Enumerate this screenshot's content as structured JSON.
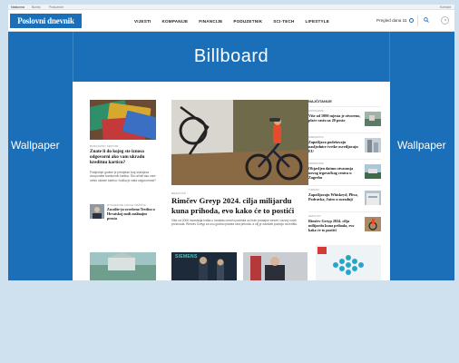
{
  "topbar": {
    "items": [
      "Naslovna",
      "Biznis",
      "Poduzeće",
      "Kontakt"
    ]
  },
  "header": {
    "logo": "Poslovni dnevnik",
    "menu": [
      "VIJESTI",
      "KOMPANIJE",
      "FINANCIJE",
      "PODUZETNIK",
      "SCI-TECH",
      "LIFESTYLE"
    ],
    "pregled_label": "Pregled dana",
    "pregled_count": "11"
  },
  "ads": {
    "billboard": "Billboard",
    "wallpaper_left": "Wallpaper",
    "wallpaper_right": "Wallpaper"
  },
  "articles": {
    "card1": {
      "tag": "BANKARSKI SEKTOR",
      "title": "Znate li do kojeg ste iznosa odgovorni ako vam ukradu kreditnu karticu?",
      "text": "Posljednje godine je primjetan broj slučajeva zlouporabe bankovnih kartica. Što učiniti ako vam netko ukrade karticu i kolika je vaša odgovornost?"
    },
    "card2": {
      "tag": "OTVARANJE NOVIH TRŽIŠTA",
      "title": "Zacalite-ju ovorkena Tredica u Hrvatskoj nuđi zaslinajne prosta"
    },
    "main": {
      "tag": "REZULTATI",
      "title": "Rimčev Greyp 2024. cilja milijardu kuna prihoda, evo kako će to postići",
      "text": "Više od 2000 investicija tvrtka u hrvatsku mrežu podrška uz brže prodajne mreže i razvoj novih proizvoda. Rimčev Greyp za ovu godinu planira rast prihoda, a cilj je zadržati poziciju na tržištu."
    }
  },
  "sidebar": {
    "title": "NAJČITANIJE",
    "items": [
      {
        "tag": "ZAPOSLENJE",
        "title": "Više od 1000 mjesta je otvoreno, plaće rastu za 20 posto"
      },
      {
        "tag": "ENERGETIKA",
        "title": "Zapošljava podržavaju nasljednice tvrtke osvetljavaju EU"
      },
      {
        "tag": "NEKRETNINE",
        "title": "Objavljen datum otvaranja novog trgovačkog centra u Zagrebu"
      },
      {
        "tag": "TURIZAM",
        "title": "Zapošljavaju Whiskeyd, Pliva, Podravka, Jutro u suradnji"
      },
      {
        "tag": "REZULTATI",
        "title": "Rimčev Greyp 2024. cilja milijardu kuna prihoda, evo kako će to postići"
      }
    ]
  },
  "bottom": {
    "siemens": "SIEMENS"
  }
}
